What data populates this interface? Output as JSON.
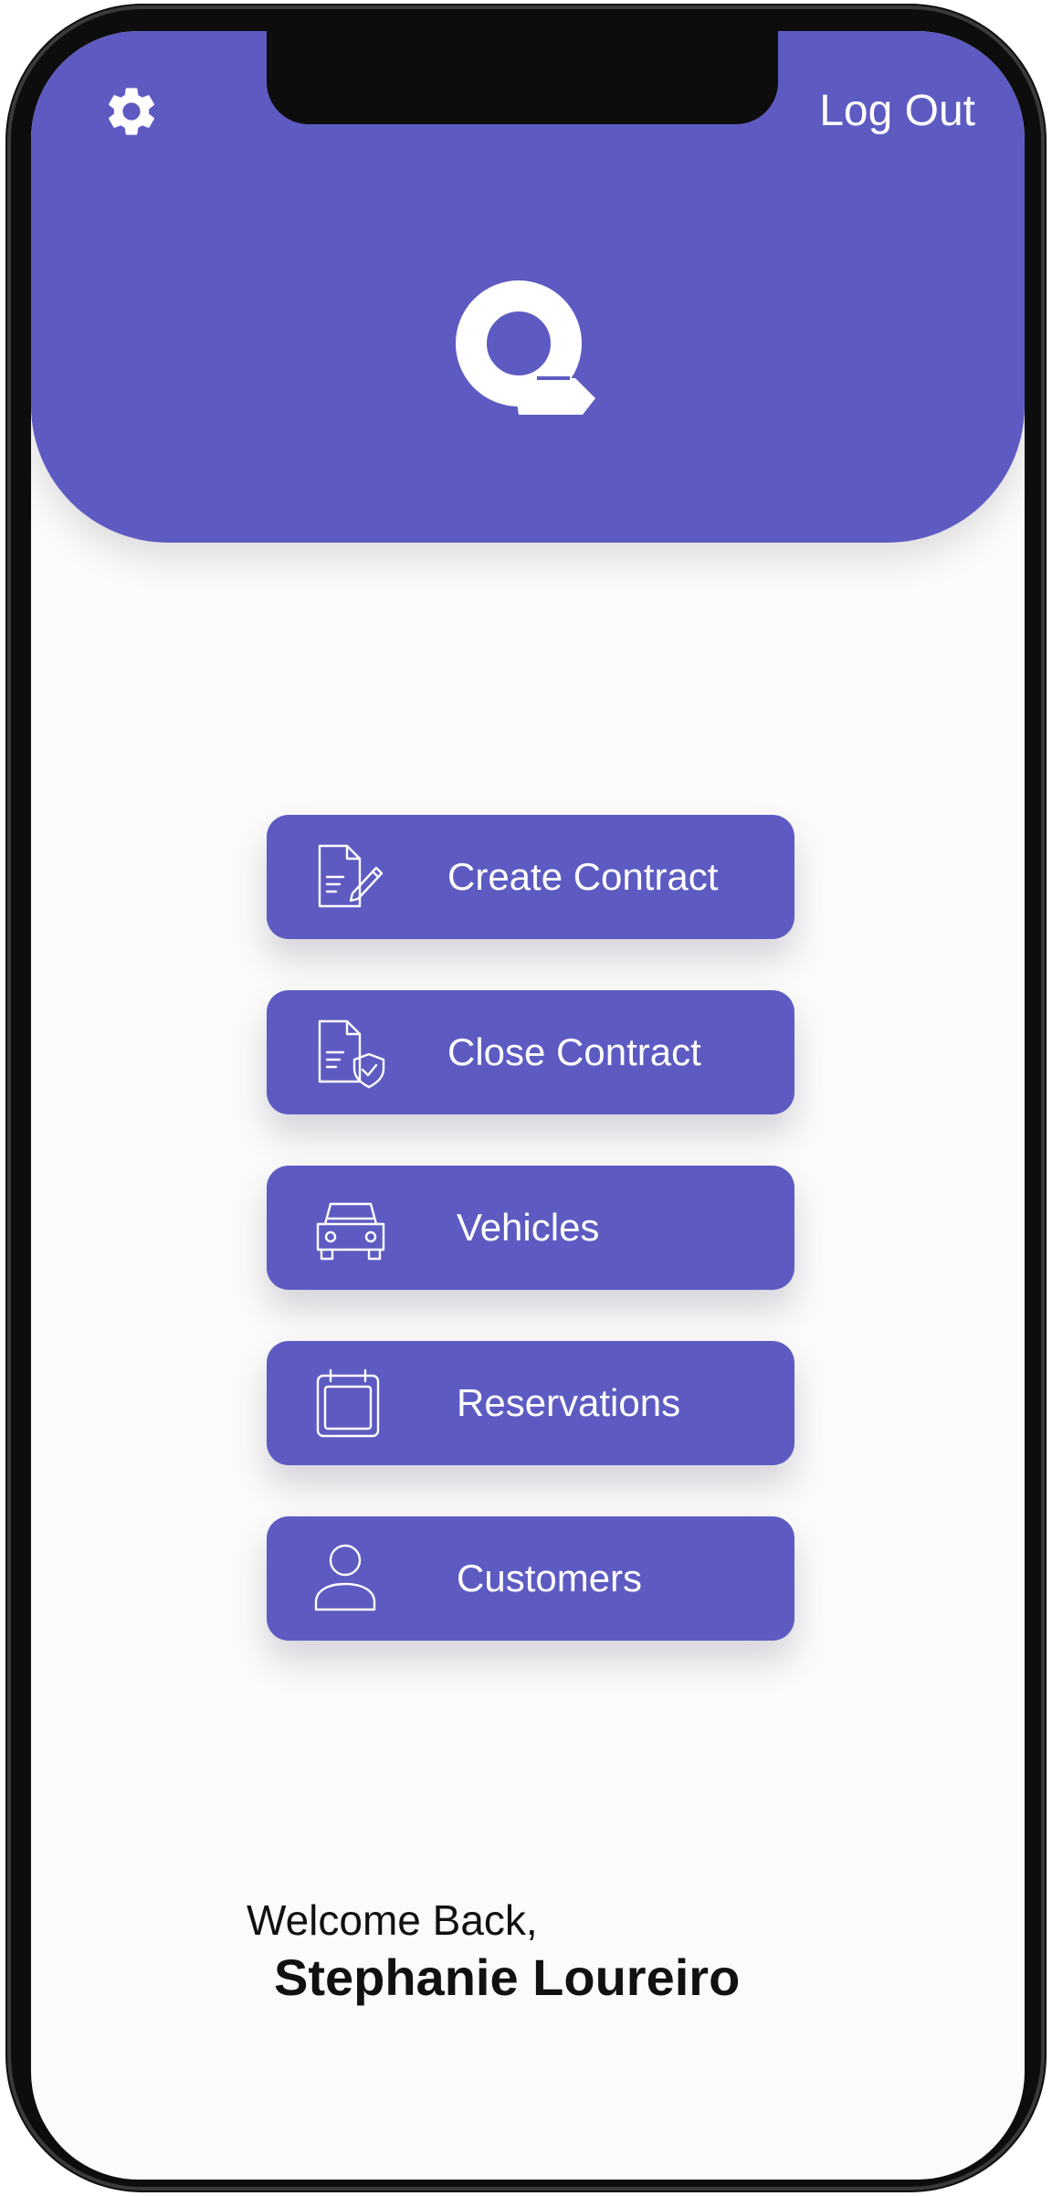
{
  "header": {
    "settings_icon": "gear-icon",
    "logout_label": "Log Out",
    "logo_icon": "q-logo-icon",
    "brand_color": "#5d5bc2"
  },
  "menu": {
    "items": [
      {
        "label": "Create Contract",
        "icon": "document-edit-icon"
      },
      {
        "label": "Close Contract",
        "icon": "document-shield-icon"
      },
      {
        "label": "Vehicles",
        "icon": "car-icon"
      },
      {
        "label": "Reservations",
        "icon": "calendar-icon"
      },
      {
        "label": "Customers",
        "icon": "user-icon"
      }
    ]
  },
  "greeting": {
    "welcome": "Welcome Back,",
    "user_name": "Stephanie Loureiro"
  }
}
